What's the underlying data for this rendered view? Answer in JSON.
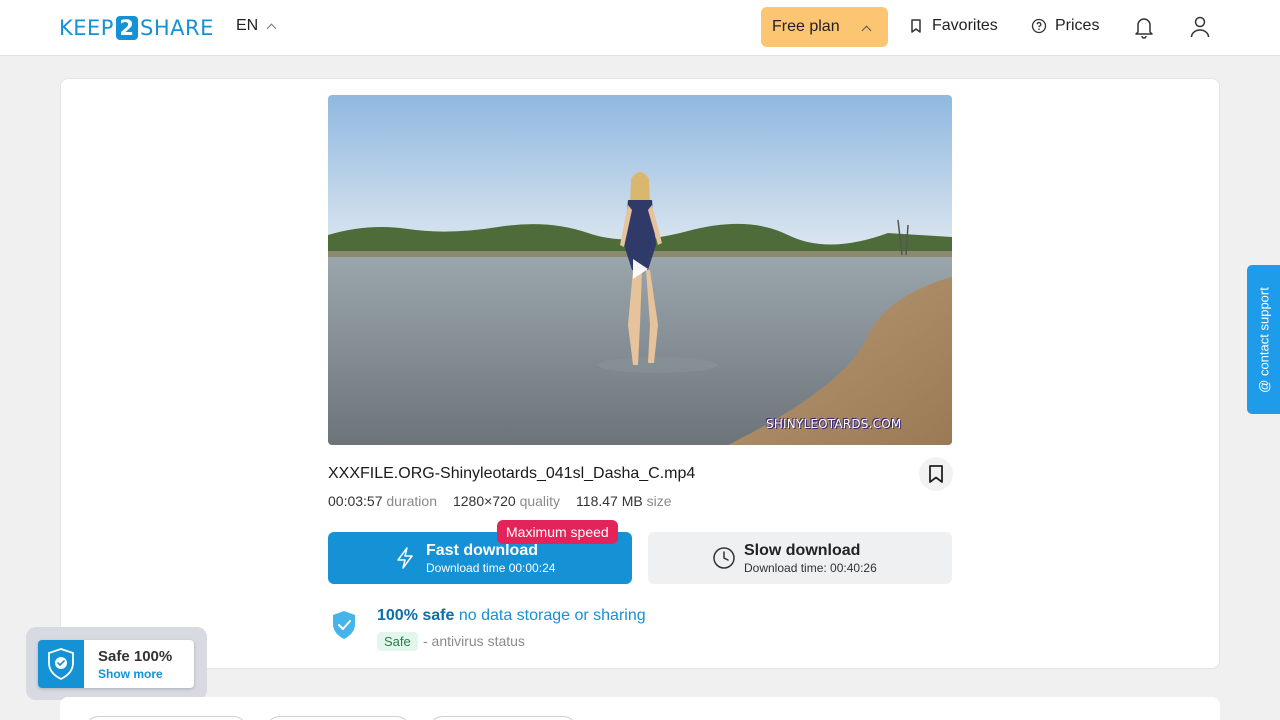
{
  "header": {
    "logo_left": "KEEP",
    "logo_num": "2",
    "logo_right": "SHARE",
    "language": "EN",
    "free_plan_label": "Free plan",
    "favorites_label": "Favorites",
    "prices_label": "Prices"
  },
  "file": {
    "name": "XXXFILE.ORG-Shinyleotards_041sl_Dasha_C.mp4",
    "duration_value": "00:03:57",
    "duration_label": "duration",
    "quality_value": "1280×720",
    "quality_label": "quality",
    "size_value": "118.47 MB",
    "size_label": "size",
    "video_watermark": "SHINYLEOTARDS.COM"
  },
  "download": {
    "badge": "Maximum speed",
    "fast_title": "Fast download",
    "fast_time": "Download time 00:00:24",
    "slow_title": "Slow download",
    "slow_time": "Download time: 00:40:26"
  },
  "safety": {
    "headline_bold": "100% safe",
    "headline_rest": "no data storage or sharing",
    "badge": "Safe",
    "status_text": "- antivirus status"
  },
  "widgets": {
    "contact_support": "@ contact support",
    "safe_title": "Safe 100%",
    "safe_more": "Show more"
  },
  "colors": {
    "brand_blue": "#1591d6",
    "free_plan_bg": "#fcc572",
    "max_speed_badge": "#e3245a",
    "page_bg": "#f0f0f0"
  }
}
